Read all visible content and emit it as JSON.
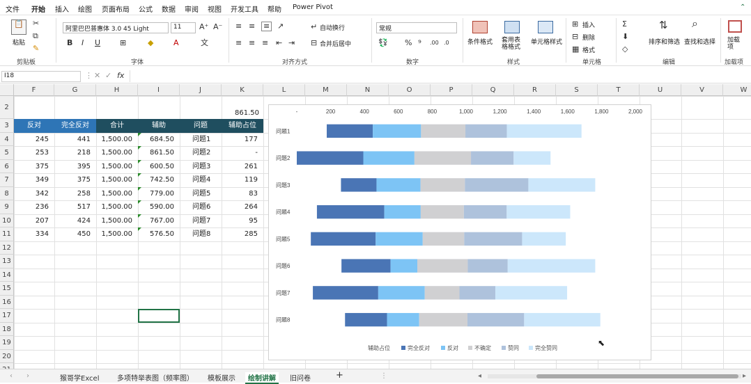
{
  "menu": {
    "items": [
      "文件",
      "开始",
      "插入",
      "绘图",
      "页面布局",
      "公式",
      "数据",
      "审阅",
      "视图",
      "开发工具",
      "帮助",
      "Power Pivot"
    ],
    "active": "开始"
  },
  "ribbon": {
    "clipboard": {
      "paste": "粘贴",
      "label": "剪贴板"
    },
    "font": {
      "name": "阿里巴巴普惠体 3.0 45 Light",
      "size": "11",
      "label": "字体"
    },
    "alignment": {
      "wrap": "自动换行",
      "merge": "合并后居中",
      "label": "对齐方式"
    },
    "number": {
      "format": "常规",
      "label": "数字"
    },
    "styles": {
      "conditional": "条件格式",
      "table": "套用表格格式",
      "cell": "单元格样式",
      "label": "样式"
    },
    "cells": {
      "insert": "插入",
      "delete": "删除",
      "format": "格式",
      "label": "单元格"
    },
    "editing": {
      "sort": "排序和筛选",
      "find": "查找和选择",
      "label": "编辑"
    },
    "addins": {
      "name": "加载项",
      "label": "加载项"
    }
  },
  "formula_bar": {
    "name_box": "I18",
    "fx": "fx",
    "value": ""
  },
  "columns": [
    "F",
    "G",
    "H",
    "I",
    "J",
    "K",
    "L",
    "M",
    "N",
    "O",
    "P",
    "Q",
    "R",
    "S",
    "T",
    "U",
    "V",
    "W"
  ],
  "rows": [
    "2",
    "3",
    "4",
    "5",
    "6",
    "7",
    "8",
    "9",
    "10",
    "11",
    "12",
    "13",
    "14",
    "15",
    "16",
    "17",
    "18",
    "19",
    "20",
    "21"
  ],
  "sheet": {
    "k2_value": "861.50",
    "headers": [
      "反对",
      "完全反对",
      "合计",
      "辅助",
      "问题",
      "辅助占位"
    ],
    "data": [
      [
        "245",
        "441",
        "1,500.00",
        "684.50",
        "问题1",
        "177"
      ],
      [
        "253",
        "218",
        "1,500.00",
        "861.50",
        "问题2",
        "-"
      ],
      [
        "375",
        "395",
        "1,500.00",
        "600.50",
        "问题3",
        "261"
      ],
      [
        "349",
        "375",
        "1,500.00",
        "742.50",
        "问题4",
        "119"
      ],
      [
        "342",
        "258",
        "1,500.00",
        "779.00",
        "问题5",
        "83"
      ],
      [
        "236",
        "517",
        "1,500.00",
        "590.00",
        "问题6",
        "264"
      ],
      [
        "207",
        "424",
        "1,500.00",
        "767.00",
        "问题7",
        "95"
      ],
      [
        "334",
        "450",
        "1,500.00",
        "576.50",
        "问题8",
        "285"
      ]
    ]
  },
  "chart_data": {
    "type": "bar",
    "orientation": "horizontal",
    "stacked": true,
    "x_ticks": [
      "-",
      "200",
      "400",
      "600",
      "800",
      "1,000",
      "1,200",
      "1,400",
      "1,600",
      "1,800",
      "2,000"
    ],
    "xlim": [
      0,
      2000
    ],
    "categories": [
      "问题1",
      "问题2",
      "问题3",
      "问题4",
      "问题5",
      "问题6",
      "问题7",
      "问题8"
    ],
    "series": [
      {
        "name": "辅助占位",
        "values": [
          177,
          0,
          261,
          119,
          83,
          264,
          95,
          285
        ],
        "color": "transparent"
      },
      {
        "name": "完全反对",
        "values": [
          272,
          393,
          210,
          398,
          383,
          290,
          386,
          248
        ],
        "color": "#4a75b5"
      },
      {
        "name": "反对",
        "values": [
          285,
          302,
          260,
          215,
          278,
          158,
          275,
          190
        ],
        "color": "#7dc4f5"
      },
      {
        "name": "不确定",
        "values": [
          262,
          334,
          262,
          255,
          245,
          298,
          205,
          285
        ],
        "color": "#d0d0d2"
      },
      {
        "name": "赞同",
        "values": [
          245,
          252,
          375,
          253,
          342,
          236,
          212,
          335
        ],
        "color": "#aec2dc"
      },
      {
        "name": "完全赞同",
        "values": [
          441,
          218,
          395,
          375,
          258,
          517,
          424,
          450
        ],
        "color": "#cce7fb"
      }
    ],
    "legend_position": "bottom",
    "grid": false
  },
  "tabs": {
    "items": [
      "猴哥学Excel",
      "多项特举表图（频率图）",
      "模板展示",
      "绘制讲解",
      "旧问卷"
    ],
    "active": "绘制讲解",
    "add": "+"
  }
}
